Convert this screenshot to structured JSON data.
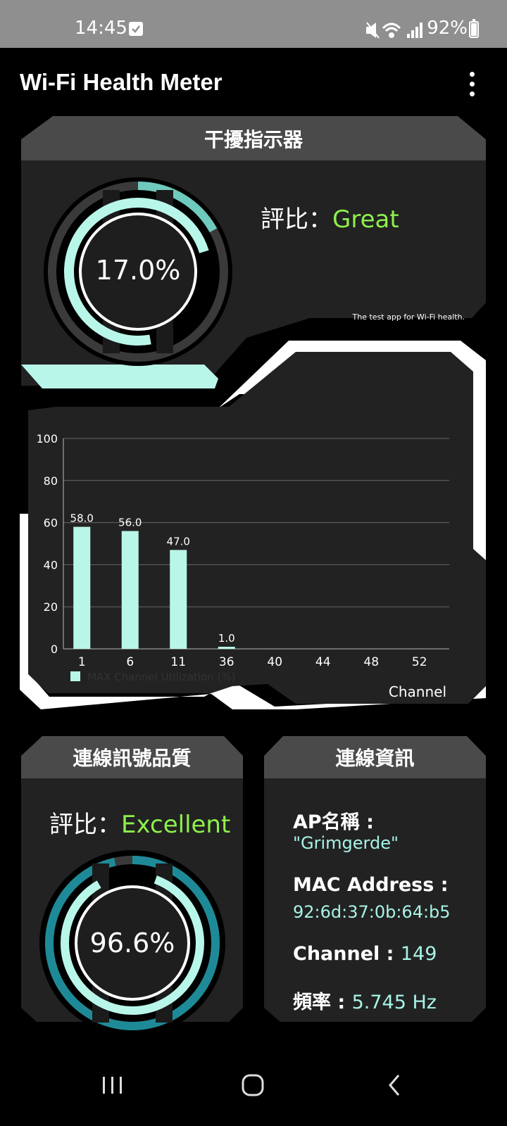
{
  "status": {
    "time": "14:45",
    "battery": "92%"
  },
  "app": {
    "title": "Wi-Fi Health Meter"
  },
  "interference": {
    "header": "干擾指示器",
    "value": "17.0%",
    "fraction": 0.17,
    "rating_label": "評比：",
    "rating_value": "Great",
    "tagline": "The test app for Wi-Fi health."
  },
  "chart_data": {
    "type": "bar",
    "categories": [
      "1",
      "6",
      "11",
      "36",
      "40",
      "44",
      "48",
      "52"
    ],
    "values": [
      58.0,
      56.0,
      47.0,
      1.0,
      0,
      0,
      0,
      0
    ],
    "labels": [
      "58.0",
      "56.0",
      "47.0",
      "1.0",
      "",
      "",
      "",
      ""
    ],
    "yticks": [
      "0",
      "20",
      "40",
      "60",
      "80",
      "100"
    ],
    "ylim": [
      0,
      100
    ],
    "legend": "MAX Channel Utilization (%)",
    "xlabel": "Channel",
    "bar_color": "#b9f6ea"
  },
  "signal": {
    "header": "連線訊號品質",
    "rating_label": "評比：",
    "rating_value": "Excellent",
    "value": "96.6%",
    "fraction": 0.966
  },
  "info": {
    "header": "連線資訊",
    "ap_label": "AP名稱 :",
    "ap_value": "\"Grimgerde\"",
    "mac_label": "MAC Address :",
    "mac_value": "92:6d:37:0b:64:b5",
    "channel_label": "Channel : ",
    "channel_value": "149",
    "freq_label": "頻率 : ",
    "freq_value": "5.745 Hz"
  },
  "colors": {
    "accent": "#b9f6ea",
    "rating": "#8ef04b",
    "panel": "#222222",
    "header": "#4a4a4a"
  }
}
